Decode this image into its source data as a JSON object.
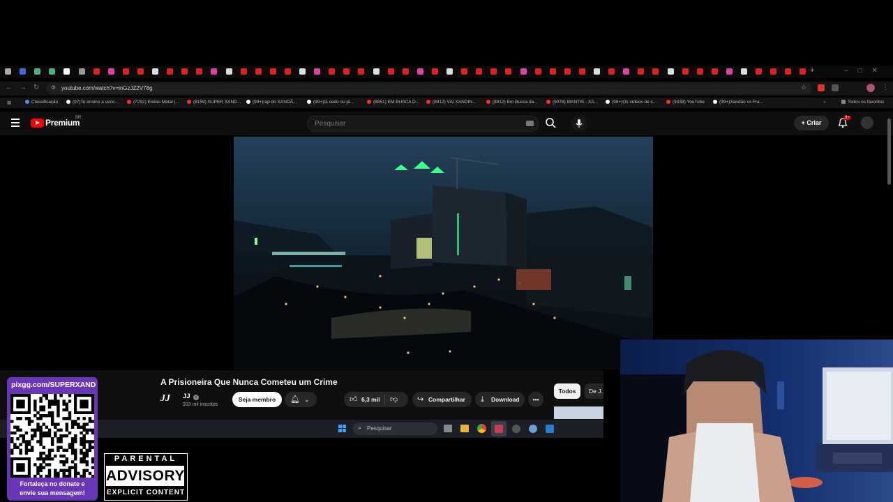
{
  "browser": {
    "url": "youtube.com/watch?v=inGzJZ2V78g",
    "bookmarks": [
      {
        "label": "Classificação",
        "color": "#5a8dee"
      },
      {
        "label": "(97)Te ensino a venc...",
        "color": "#ffffff"
      },
      {
        "label": "(7292) Enéas Metal |...",
        "color": "#ff2d2d"
      },
      {
        "label": "(8159) SUPER XAND...",
        "color": "#ff2d2d"
      },
      {
        "label": "(99+)rap do XANDÃ...",
        "color": "#ffffff"
      },
      {
        "label": "(99+)tá cedo ou já...",
        "color": "#ffffff"
      },
      {
        "label": "(8851) EM BUSCA D...",
        "color": "#ff2d2d"
      },
      {
        "label": "(8912) VAI XANDIN...",
        "color": "#ff2d2d"
      },
      {
        "label": "(8912) Em Busca da...",
        "color": "#ff2d2d"
      },
      {
        "label": "(9078) MANTIS - XA...",
        "color": "#ff2d2d"
      },
      {
        "label": "(99+)Os vídeos de c...",
        "color": "#ffffff"
      },
      {
        "label": "(9338) YouTube",
        "color": "#ff2d2d"
      },
      {
        "label": "(99+)Xandão vs Fra...",
        "color": "#ffffff"
      }
    ],
    "all_bookmarks": "Todos os favoritos"
  },
  "youtube": {
    "logo_text": "Premium",
    "region": "BR",
    "search_placeholder": "Pesquisar",
    "create_label": "Criar",
    "notifications": "9+"
  },
  "video": {
    "title": "A Prisioneira Que Nunca Cometeu um Crime",
    "channel": "JJ",
    "channel_logo": "JJ",
    "subscribers": "933 mil inscritos",
    "join_label": "Seja membro",
    "likes": "6,3 mil",
    "share_label": "Compartilhar",
    "download_label": "Download",
    "chip_all": "Todos",
    "chip_other": "De J..."
  },
  "taskbar": {
    "search_placeholder": "Pesquisar"
  },
  "overlay": {
    "qr_url": "pixgg.com/SUPERXAND",
    "qr_caption_1": "Fortaleça no donate e",
    "qr_caption_2": "envie sua mensagem!",
    "advisory_1": "PARENTAL",
    "advisory_2": "ADVISORY",
    "advisory_3": "EXPLICIT CONTENT"
  },
  "colors": {
    "youtube_red": "#ff0000",
    "qr_purple": "#6a36b8",
    "page_bg": "#0f0f0f"
  }
}
